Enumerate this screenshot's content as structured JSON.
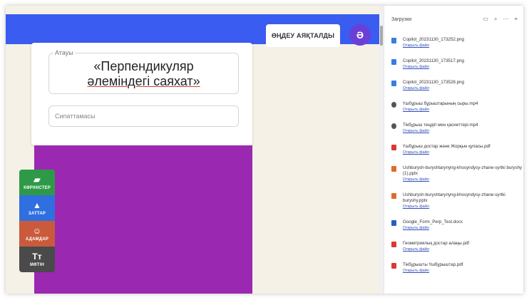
{
  "toolbar": {
    "edit_title_label": "ӨҢДЕУ АЯҚТАЛДЫ",
    "avatar_letter": "Ә"
  },
  "form": {
    "name_label": "Атауы",
    "name_line1": "«Перпендикуляр",
    "name_line2": "әлеміндегі саяхат»",
    "description_placeholder": "Сипаттамасы"
  },
  "tools": [
    {
      "label": "КӨРІНІСТЕР",
      "icon": "▰"
    },
    {
      "label": "ЗАТТАР",
      "icon": "▲"
    },
    {
      "label": "АДАМДАР",
      "icon": "☺"
    },
    {
      "label": "МӘТІН",
      "icon": "Tт"
    }
  ],
  "downloads": {
    "title": "Загрузки",
    "icons": [
      "folder-icon",
      "search-icon",
      "more-icon",
      "pin-icon"
    ],
    "open_label": "Открыть файл",
    "items": [
      {
        "name": "Copilot_20231130_173252.png",
        "type": "image"
      },
      {
        "name": "Copilot_20231130_173517.png",
        "type": "image"
      },
      {
        "name": "Copilot_20231130_173528.png",
        "type": "image"
      },
      {
        "name": "Үшбұрыш бұрыштарының сыры.mp4",
        "type": "video"
      },
      {
        "name": "Тікбұрыш теңдігі мен қасиеттері.mp4",
        "type": "video"
      },
      {
        "name": "Үшбұрыш достар және Жорқын қуласы.pdf",
        "type": "pdf"
      },
      {
        "name": "Ushburysh-buryshtarynyng-khosyndysy-zhane-syrtki buryshy (1).pptx",
        "type": "pptx"
      },
      {
        "name": "Ushburysh-buryshtarynyng-khosyndysy-zhane-syrtki buryshy.pptx",
        "type": "pptx"
      },
      {
        "name": "Google_Form_Perp_Test.docx",
        "type": "docx"
      },
      {
        "name": "Геометриялық достар алаңы.pdf",
        "type": "pdf"
      },
      {
        "name": "Тікбұрышты Үшбұрыштар.pdf",
        "type": "pdf"
      }
    ]
  }
}
